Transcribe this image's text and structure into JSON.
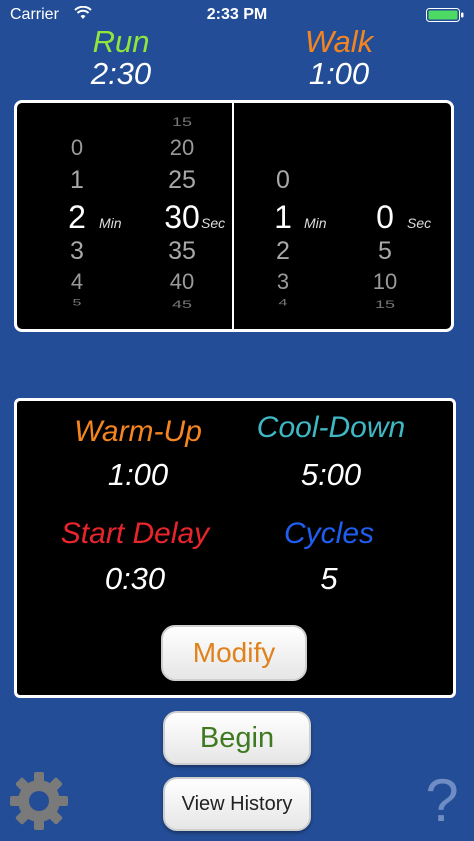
{
  "status_bar": {
    "carrier": "Carrier",
    "time": "2:33 PM"
  },
  "header": {
    "run": {
      "label": "Run",
      "time": "2:30",
      "color": "#8fe63c"
    },
    "walk": {
      "label": "Walk",
      "time": "1:00",
      "color": "#f5861f"
    }
  },
  "picker": {
    "run_minutes": {
      "items": [
        "0",
        "1",
        "2",
        "3",
        "4",
        "5"
      ],
      "selected": "2",
      "unit": "Min"
    },
    "run_seconds": {
      "items": [
        "15",
        "20",
        "25",
        "30",
        "35",
        "40",
        "45"
      ],
      "selected": "30",
      "unit": "Sec"
    },
    "walk_minutes": {
      "items": [
        "0",
        "1",
        "2",
        "3",
        "4"
      ],
      "selected": "1",
      "unit": "Min"
    },
    "walk_seconds": {
      "items": [
        "0",
        "5",
        "10",
        "15"
      ],
      "selected": "0",
      "unit": "Sec"
    }
  },
  "settings": {
    "warmup": {
      "label": "Warm-Up",
      "value": "1:00",
      "color": "#f5861f"
    },
    "cooldown": {
      "label": "Cool-Down",
      "value": "5:00",
      "color": "#3fb8c4"
    },
    "start_delay": {
      "label": "Start Delay",
      "value": "0:30",
      "color": "#e8252c"
    },
    "cycles": {
      "label": "Cycles",
      "value": "5",
      "color": "#1f5ef0"
    },
    "modify_label": "Modify",
    "modify_color": "#e0821c"
  },
  "buttons": {
    "begin_label": "Begin",
    "begin_color": "#3f7a22",
    "history_label": "View History"
  },
  "icons": {
    "settings": "gear-icon",
    "help": "help-icon"
  }
}
